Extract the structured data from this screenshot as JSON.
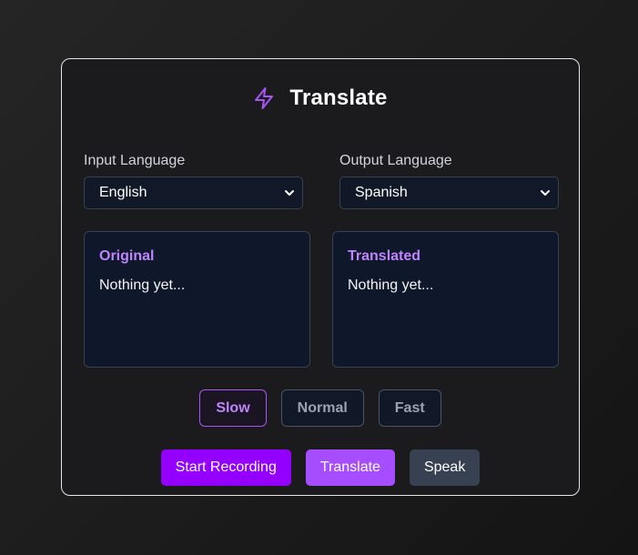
{
  "header": {
    "icon": "lightning-bolt-icon",
    "title": "Translate",
    "accent_color": "#a855f7"
  },
  "languages": {
    "input": {
      "label": "Input Language",
      "selected": "English"
    },
    "output": {
      "label": "Output Language",
      "selected": "Spanish"
    }
  },
  "panels": {
    "original": {
      "title": "Original",
      "text": "Nothing yet..."
    },
    "translated": {
      "title": "Translated",
      "text": "Nothing yet..."
    }
  },
  "speed": {
    "selected": "Slow",
    "options": [
      "Slow",
      "Normal",
      "Fast"
    ]
  },
  "actions": {
    "record_label": "Start Recording",
    "translate_label": "Translate",
    "speak_label": "Speak"
  }
}
